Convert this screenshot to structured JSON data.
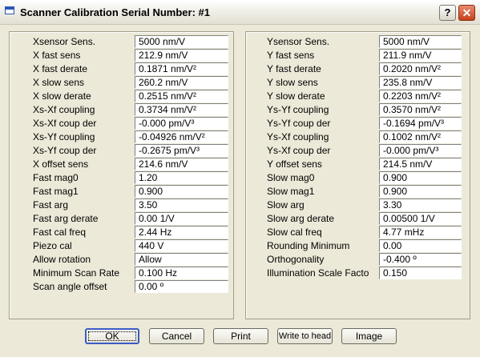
{
  "window": {
    "title": "Scanner Calibration  Serial Number: #1",
    "help_label": "?",
    "close_label": "✕"
  },
  "left_fields": [
    {
      "label": "Xsensor Sens.",
      "value": "5000 nm/V"
    },
    {
      "label": "X fast sens",
      "value": "212.9 nm/V"
    },
    {
      "label": "X fast derate",
      "value": "0.1871 nm/V²"
    },
    {
      "label": "X slow sens",
      "value": "260.2 nm/V"
    },
    {
      "label": "X slow derate",
      "value": "0.2515 nm/V²"
    },
    {
      "label": "Xs-Xf coupling",
      "value": "0.3734 nm/V²"
    },
    {
      "label": "Xs-Xf coup der",
      "value": "-0.000 pm/V³"
    },
    {
      "label": "Xs-Yf coupling",
      "value": "-0.04926 nm/V²"
    },
    {
      "label": "Xs-Yf coup der",
      "value": "-0.2675 pm/V³"
    },
    {
      "label": "X offset sens",
      "value": "214.6 nm/V"
    },
    {
      "label": "Fast mag0",
      "value": "1.20"
    },
    {
      "label": "Fast mag1",
      "value": "0.900"
    },
    {
      "label": "Fast arg",
      "value": "3.50"
    },
    {
      "label": "Fast arg derate",
      "value": "0.00 1/V"
    },
    {
      "label": "Fast cal freq",
      "value": "2.44 Hz"
    },
    {
      "label": "Piezo cal",
      "value": "440 V"
    },
    {
      "label": "Allow rotation",
      "value": "Allow"
    },
    {
      "label": "Minimum Scan Rate",
      "value": "0.100 Hz"
    },
    {
      "label": "Scan angle offset",
      "value": "0.00 º"
    }
  ],
  "right_fields": [
    {
      "label": "Ysensor Sens.",
      "value": "5000 nm/V"
    },
    {
      "label": "Y fast sens",
      "value": "211.9 nm/V"
    },
    {
      "label": "Y fast derate",
      "value": "0.2020 nm/V²"
    },
    {
      "label": "Y slow sens",
      "value": "235.8 nm/V"
    },
    {
      "label": "Y slow derate",
      "value": "0.2203 nm/V²"
    },
    {
      "label": "Ys-Yf coupling",
      "value": "0.3570 nm/V²"
    },
    {
      "label": "Ys-Yf coup der",
      "value": "-0.1694 pm/V³"
    },
    {
      "label": "Ys-Xf coupling",
      "value": "0.1002 nm/V²"
    },
    {
      "label": "Ys-Xf coup der",
      "value": "-0.000 pm/V³"
    },
    {
      "label": "Y offset sens",
      "value": "214.5 nm/V"
    },
    {
      "label": "Slow mag0",
      "value": "0.900"
    },
    {
      "label": "Slow mag1",
      "value": "0.900"
    },
    {
      "label": "Slow arg",
      "value": "3.30"
    },
    {
      "label": "Slow arg derate",
      "value": "0.00500 1/V"
    },
    {
      "label": "Slow cal freq",
      "value": "4.77 mHz"
    },
    {
      "label": "Rounding Minimum",
      "value": "0.00"
    },
    {
      "label": "Orthogonality",
      "value": "-0.400 º"
    },
    {
      "label": "Illumination Scale Facto",
      "value": "0.150"
    }
  ],
  "buttons": {
    "ok": "OK",
    "cancel": "Cancel",
    "print": "Print",
    "write": "Write to head",
    "image": "Image"
  }
}
